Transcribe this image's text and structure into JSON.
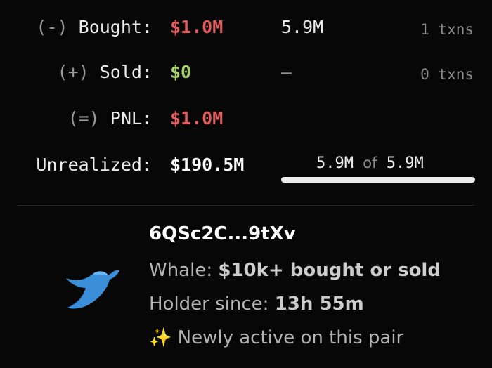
{
  "trades": {
    "bought": {
      "sign": "(-)",
      "label": "Bought:",
      "amount": "$1.0M",
      "tokens": "5.9M",
      "txns": "1 txns"
    },
    "sold": {
      "sign": "(+)",
      "label": "Sold:",
      "amount": "$0",
      "tokens": "—",
      "txns": "0 txns"
    },
    "pnl": {
      "sign": "(=)",
      "label": "PNL:",
      "amount": "$1.0M"
    },
    "unrealized": {
      "label": "Unrealized:",
      "amount": "$190.5M",
      "held": "5.9M",
      "of_word": "of",
      "total": "5.9M",
      "held_fraction": 1.0
    }
  },
  "trader": {
    "icon": "whale-icon",
    "wallet": "6QSc2C...9tXv",
    "badge_prefix": "Whale: ",
    "badge_value": "$10k+ bought or sold",
    "holder_prefix": "Holder since: ",
    "holder_value": "13h 55m",
    "activity_icon": "sparkles",
    "activity_emoji": "✨",
    "activity_text": "Newly active on this pair"
  },
  "colors": {
    "negative": "#e35d5d",
    "positive": "#a6d26b",
    "background": "#070707"
  }
}
